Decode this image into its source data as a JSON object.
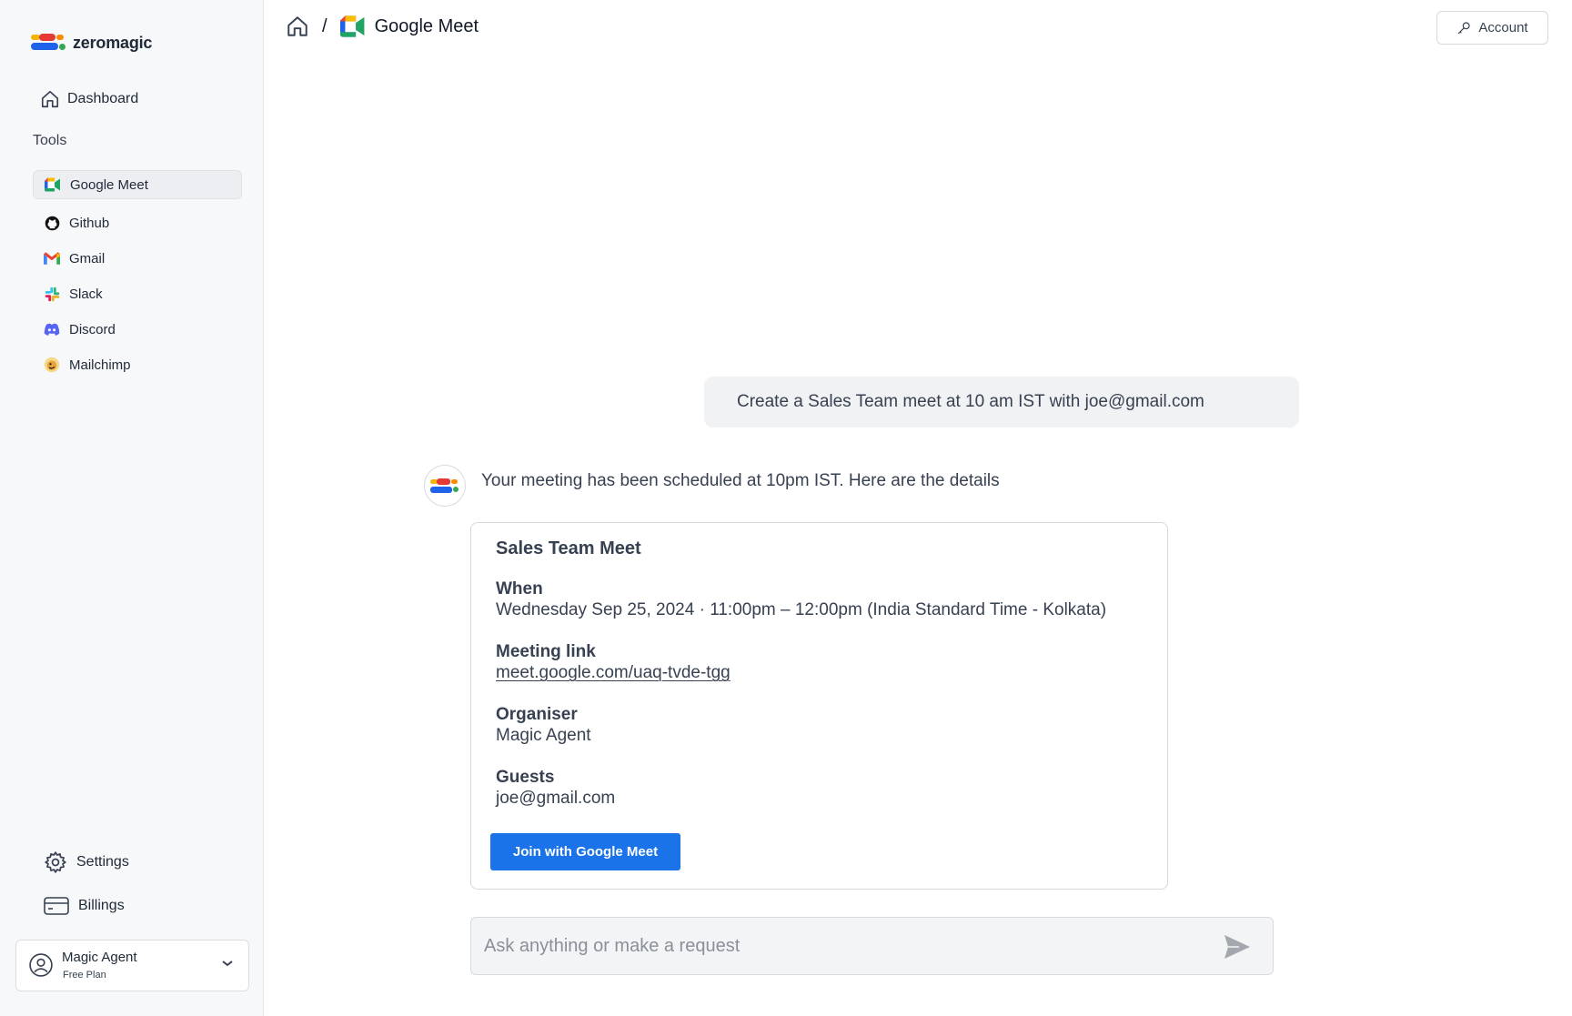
{
  "brand": {
    "name": "zeromagic"
  },
  "sidebar": {
    "dashboard_label": "Dashboard",
    "tools_heading": "Tools",
    "tools": [
      {
        "label": "Google Meet",
        "icon": "google-meet-icon",
        "active": true
      },
      {
        "label": "Github",
        "icon": "github-icon",
        "active": false
      },
      {
        "label": "Gmail",
        "icon": "gmail-icon",
        "active": false
      },
      {
        "label": "Slack",
        "icon": "slack-icon",
        "active": false
      },
      {
        "label": "Discord",
        "icon": "discord-icon",
        "active": false
      },
      {
        "label": "Mailchimp",
        "icon": "mailchimp-icon",
        "active": false
      }
    ],
    "settings_label": "Settings",
    "billings_label": "Billings",
    "user": {
      "name": "Magic Agent",
      "plan": "Free Plan"
    }
  },
  "header": {
    "breadcrumb_separator": "/",
    "breadcrumb_current": "Google Meet",
    "account_label": "Account"
  },
  "chat": {
    "user_message": "Create a Sales Team meet at 10 am IST with joe@gmail.com",
    "agent_message": "Your meeting has been scheduled at 10pm IST. Here are the details",
    "meeting": {
      "title": "Sales Team Meet",
      "when_label": "When",
      "when_value": "Wednesday Sep 25, 2024 · 11:00pm – 12:00pm (India Standard Time - Kolkata)",
      "link_label": "Meeting link",
      "link_value": "meet.google.com/uaq-tvde-tgg",
      "organiser_label": "Organiser",
      "organiser_value": "Magic Agent",
      "guests_label": "Guests",
      "guests_value": "joe@gmail.com",
      "join_label": "Join with Google Meet"
    },
    "composer_placeholder": "Ask anything or make a request"
  },
  "colors": {
    "primary_button": "#1a73e8",
    "sidebar_bg": "#f7f8fa"
  }
}
